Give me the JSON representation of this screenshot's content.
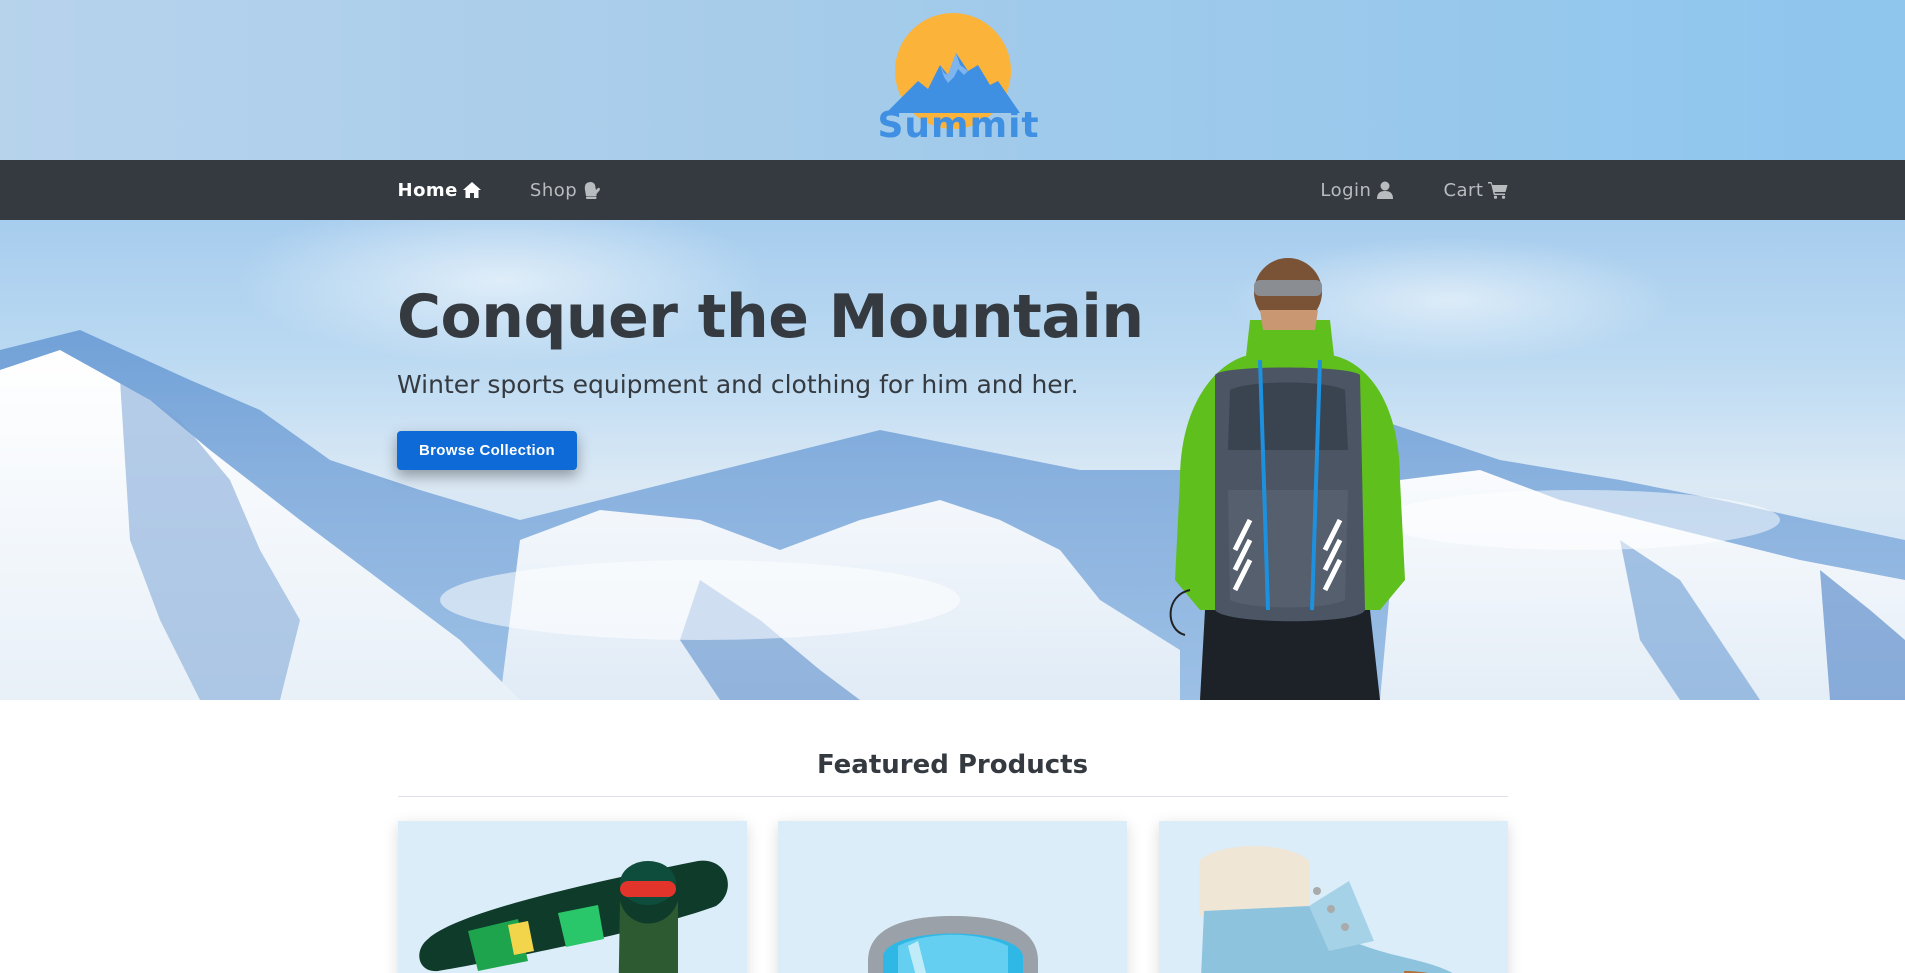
{
  "brand": {
    "logo_text": "Summit",
    "logo_icon": "mountain-sun-logo",
    "sun_color": "#fbb33a",
    "mountain_color": "#3f8fe3"
  },
  "nav": {
    "left": [
      {
        "label": "Home",
        "icon": "home-icon",
        "active": true
      },
      {
        "label": "Shop",
        "icon": "mitten-icon",
        "active": false
      }
    ],
    "right": [
      {
        "label": "Login",
        "icon": "user-icon",
        "active": false
      },
      {
        "label": "Cart",
        "icon": "shopping-cart-icon",
        "active": false
      }
    ]
  },
  "hero": {
    "title": "Conquer the Mountain",
    "subtitle": "Winter sports equipment and clothing for him and her.",
    "cta_label": "Browse Collection",
    "cta_color": "#0d6ad6"
  },
  "featured": {
    "title": "Featured Products",
    "products": [
      {
        "image": "snowboarder-with-snowboard"
      },
      {
        "image": "ski-goggles"
      },
      {
        "image": "light-blue-winter-boot"
      }
    ]
  },
  "colors": {
    "navbar_bg": "#343a40",
    "text_dark": "#343a40",
    "card_bg": "#dcedfa"
  }
}
